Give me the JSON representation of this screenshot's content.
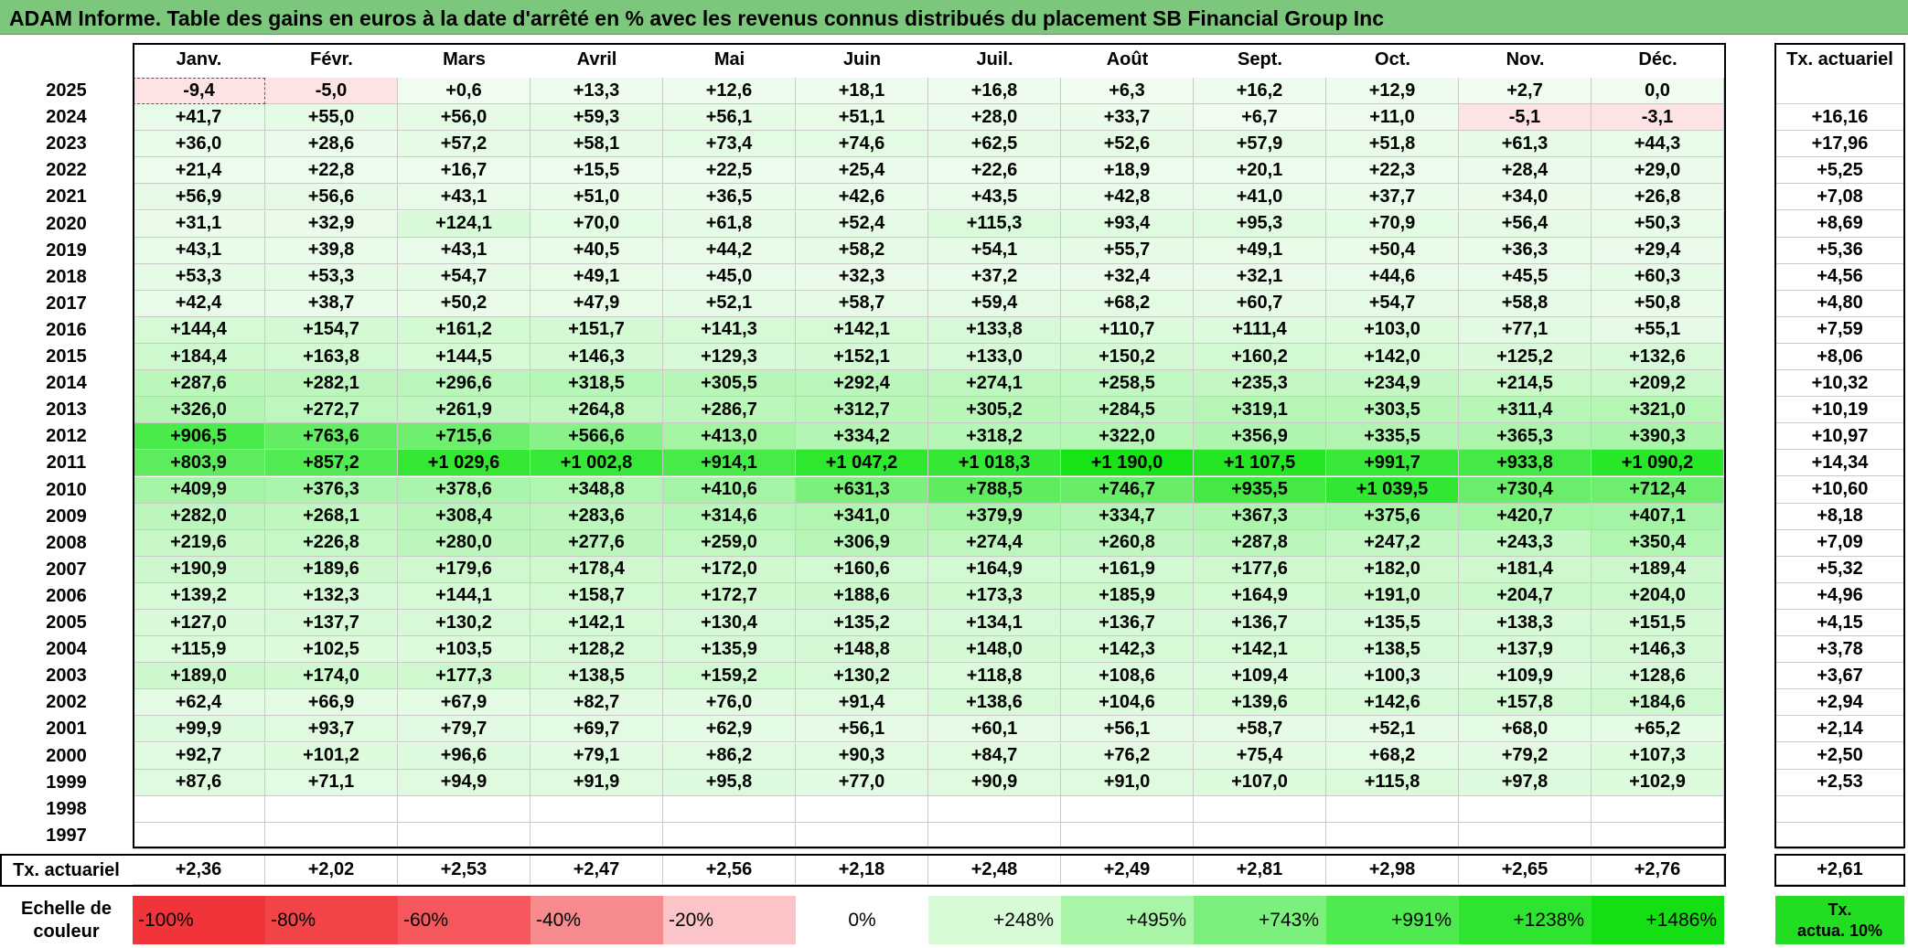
{
  "title": "ADAM Informe. Table des gains en euros à la date d'arrêté en % avec les revenus connus distribués du placement SB Financial Group Inc",
  "months": [
    "Janv.",
    "Févr.",
    "Mars",
    "Avril",
    "Mai",
    "Juin",
    "Juil.",
    "Août",
    "Sept.",
    "Oct.",
    "Nov.",
    "Déc."
  ],
  "annual_header": "Tx. actuariel",
  "rows": [
    {
      "year": "2025",
      "values": [
        "-9,4",
        "-5,0",
        "+0,6",
        "+13,3",
        "+12,6",
        "+18,1",
        "+16,8",
        "+6,3",
        "+16,2",
        "+12,9",
        "+2,7",
        "0,0"
      ],
      "annual": ""
    },
    {
      "year": "2024",
      "values": [
        "+41,7",
        "+55,0",
        "+56,0",
        "+59,3",
        "+56,1",
        "+51,1",
        "+28,0",
        "+33,7",
        "+6,7",
        "+11,0",
        "-5,1",
        "-3,1"
      ],
      "annual": "+16,16"
    },
    {
      "year": "2023",
      "values": [
        "+36,0",
        "+28,6",
        "+57,2",
        "+58,1",
        "+73,4",
        "+74,6",
        "+62,5",
        "+52,6",
        "+57,9",
        "+51,8",
        "+61,3",
        "+44,3"
      ],
      "annual": "+17,96"
    },
    {
      "year": "2022",
      "values": [
        "+21,4",
        "+22,8",
        "+16,7",
        "+15,5",
        "+22,5",
        "+25,4",
        "+22,6",
        "+18,9",
        "+20,1",
        "+22,3",
        "+28,4",
        "+29,0"
      ],
      "annual": "+5,25"
    },
    {
      "year": "2021",
      "values": [
        "+56,9",
        "+56,6",
        "+43,1",
        "+51,0",
        "+36,5",
        "+42,6",
        "+43,5",
        "+42,8",
        "+41,0",
        "+37,7",
        "+34,0",
        "+26,8"
      ],
      "annual": "+7,08"
    },
    {
      "year": "2020",
      "values": [
        "+31,1",
        "+32,9",
        "+124,1",
        "+70,0",
        "+61,8",
        "+52,4",
        "+115,3",
        "+93,4",
        "+95,3",
        "+70,9",
        "+56,4",
        "+50,3"
      ],
      "annual": "+8,69"
    },
    {
      "year": "2019",
      "values": [
        "+43,1",
        "+39,8",
        "+43,1",
        "+40,5",
        "+44,2",
        "+58,2",
        "+54,1",
        "+55,7",
        "+49,1",
        "+50,4",
        "+36,3",
        "+29,4"
      ],
      "annual": "+5,36"
    },
    {
      "year": "2018",
      "values": [
        "+53,3",
        "+53,3",
        "+54,7",
        "+49,1",
        "+45,0",
        "+32,3",
        "+37,2",
        "+32,4",
        "+32,1",
        "+44,6",
        "+45,5",
        "+60,3"
      ],
      "annual": "+4,56"
    },
    {
      "year": "2017",
      "values": [
        "+42,4",
        "+38,7",
        "+50,2",
        "+47,9",
        "+52,1",
        "+58,7",
        "+59,4",
        "+68,2",
        "+60,7",
        "+54,7",
        "+58,8",
        "+50,8"
      ],
      "annual": "+4,80"
    },
    {
      "year": "2016",
      "values": [
        "+144,4",
        "+154,7",
        "+161,2",
        "+151,7",
        "+141,3",
        "+142,1",
        "+133,8",
        "+110,7",
        "+111,4",
        "+103,0",
        "+77,1",
        "+55,1"
      ],
      "annual": "+7,59"
    },
    {
      "year": "2015",
      "values": [
        "+184,4",
        "+163,8",
        "+144,5",
        "+146,3",
        "+129,3",
        "+152,1",
        "+133,0",
        "+150,2",
        "+160,2",
        "+142,0",
        "+125,2",
        "+132,6"
      ],
      "annual": "+8,06"
    },
    {
      "year": "2014",
      "values": [
        "+287,6",
        "+282,1",
        "+296,6",
        "+318,5",
        "+305,5",
        "+292,4",
        "+274,1",
        "+258,5",
        "+235,3",
        "+234,9",
        "+214,5",
        "+209,2"
      ],
      "annual": "+10,32"
    },
    {
      "year": "2013",
      "values": [
        "+326,0",
        "+272,7",
        "+261,9",
        "+264,8",
        "+286,7",
        "+312,7",
        "+305,2",
        "+284,5",
        "+319,1",
        "+303,5",
        "+311,4",
        "+321,0"
      ],
      "annual": "+10,19"
    },
    {
      "year": "2012",
      "values": [
        "+906,5",
        "+763,6",
        "+715,6",
        "+566,6",
        "+413,0",
        "+334,2",
        "+318,2",
        "+322,0",
        "+356,9",
        "+335,5",
        "+365,3",
        "+390,3"
      ],
      "annual": "+10,97"
    },
    {
      "year": "2011",
      "values": [
        "+803,9",
        "+857,2",
        "+1 029,6",
        "+1 002,8",
        "+914,1",
        "+1 047,2",
        "+1 018,3",
        "+1 190,0",
        "+1 107,5",
        "+991,7",
        "+933,8",
        "+1 090,2"
      ],
      "annual": "+14,34"
    },
    {
      "year": "2010",
      "values": [
        "+409,9",
        "+376,3",
        "+378,6",
        "+348,8",
        "+410,6",
        "+631,3",
        "+788,5",
        "+746,7",
        "+935,5",
        "+1 039,5",
        "+730,4",
        "+712,4"
      ],
      "annual": "+10,60"
    },
    {
      "year": "2009",
      "values": [
        "+282,0",
        "+268,1",
        "+308,4",
        "+283,6",
        "+314,6",
        "+341,0",
        "+379,9",
        "+334,7",
        "+367,3",
        "+375,6",
        "+420,7",
        "+407,1"
      ],
      "annual": "+8,18"
    },
    {
      "year": "2008",
      "values": [
        "+219,6",
        "+226,8",
        "+280,0",
        "+277,6",
        "+259,0",
        "+306,9",
        "+274,4",
        "+260,8",
        "+287,8",
        "+247,2",
        "+243,3",
        "+350,4"
      ],
      "annual": "+7,09"
    },
    {
      "year": "2007",
      "values": [
        "+190,9",
        "+189,6",
        "+179,6",
        "+178,4",
        "+172,0",
        "+160,6",
        "+164,9",
        "+161,9",
        "+177,6",
        "+182,0",
        "+181,4",
        "+189,4"
      ],
      "annual": "+5,32"
    },
    {
      "year": "2006",
      "values": [
        "+139,2",
        "+132,3",
        "+144,1",
        "+158,7",
        "+172,7",
        "+188,6",
        "+173,3",
        "+185,9",
        "+164,9",
        "+191,0",
        "+204,7",
        "+204,0"
      ],
      "annual": "+4,96"
    },
    {
      "year": "2005",
      "values": [
        "+127,0",
        "+137,7",
        "+130,2",
        "+142,1",
        "+130,4",
        "+135,2",
        "+134,1",
        "+136,7",
        "+136,7",
        "+135,5",
        "+138,3",
        "+151,5"
      ],
      "annual": "+4,15"
    },
    {
      "year": "2004",
      "values": [
        "+115,9",
        "+102,5",
        "+103,5",
        "+128,2",
        "+135,9",
        "+148,8",
        "+148,0",
        "+142,3",
        "+142,1",
        "+138,5",
        "+137,9",
        "+146,3"
      ],
      "annual": "+3,78"
    },
    {
      "year": "2003",
      "values": [
        "+189,0",
        "+174,0",
        "+177,3",
        "+138,5",
        "+159,2",
        "+130,2",
        "+118,8",
        "+108,6",
        "+109,4",
        "+100,3",
        "+109,9",
        "+128,6"
      ],
      "annual": "+3,67"
    },
    {
      "year": "2002",
      "values": [
        "+62,4",
        "+66,9",
        "+67,9",
        "+82,7",
        "+76,0",
        "+91,4",
        "+138,6",
        "+104,6",
        "+139,6",
        "+142,6",
        "+157,8",
        "+184,6"
      ],
      "annual": "+2,94"
    },
    {
      "year": "2001",
      "values": [
        "+99,9",
        "+93,7",
        "+79,7",
        "+69,7",
        "+62,9",
        "+56,1",
        "+60,1",
        "+56,1",
        "+58,7",
        "+52,1",
        "+68,0",
        "+65,2"
      ],
      "annual": "+2,14"
    },
    {
      "year": "2000",
      "values": [
        "+92,7",
        "+101,2",
        "+96,6",
        "+79,1",
        "+86,2",
        "+90,3",
        "+84,7",
        "+76,2",
        "+75,4",
        "+68,2",
        "+79,2",
        "+107,3"
      ],
      "annual": "+2,50"
    },
    {
      "year": "1999",
      "values": [
        "+87,6",
        "+71,1",
        "+94,9",
        "+91,9",
        "+95,8",
        "+77,0",
        "+90,9",
        "+91,0",
        "+107,0",
        "+115,8",
        "+97,8",
        "+102,9"
      ],
      "annual": "+2,53"
    },
    {
      "year": "1998",
      "values": [
        "",
        "",
        "",
        "",
        "",
        "",
        "",
        "",
        "",
        "",
        "",
        ""
      ],
      "annual": ""
    },
    {
      "year": "1997",
      "values": [
        "",
        "",
        "",
        "",
        "",
        "",
        "",
        "",
        "",
        "",
        "",
        ""
      ],
      "annual": ""
    }
  ],
  "footer": {
    "label": "Tx. actuariel",
    "values": [
      "+2,36",
      "+2,02",
      "+2,53",
      "+2,47",
      "+2,56",
      "+2,18",
      "+2,48",
      "+2,49",
      "+2,81",
      "+2,98",
      "+2,65",
      "+2,76"
    ],
    "annual": "+2,61"
  },
  "scale": {
    "label_line1": "Echelle de",
    "label_line2": "couleur",
    "steps": [
      {
        "label": "-100%",
        "color": "#f0343a"
      },
      {
        "label": "-80%",
        "color": "#f24349"
      },
      {
        "label": "-60%",
        "color": "#f4585d"
      },
      {
        "label": "-40%",
        "color": "#f78a8d"
      },
      {
        "label": "-20%",
        "color": "#fbc4c6"
      },
      {
        "label": "0%",
        "color": "#ffffff"
      },
      {
        "label": "+248%",
        "color": "#d6fbd6"
      },
      {
        "label": "+495%",
        "color": "#a8f5a8"
      },
      {
        "label": "+743%",
        "color": "#7cf07c"
      },
      {
        "label": "+991%",
        "color": "#4fea4f"
      },
      {
        "label": "+1238%",
        "color": "#2ee42e"
      },
      {
        "label": "+1486%",
        "color": "#14df14"
      }
    ],
    "right_line1": "Tx.",
    "right_line2": "actua. 10%",
    "right_color": "#22dd22"
  }
}
